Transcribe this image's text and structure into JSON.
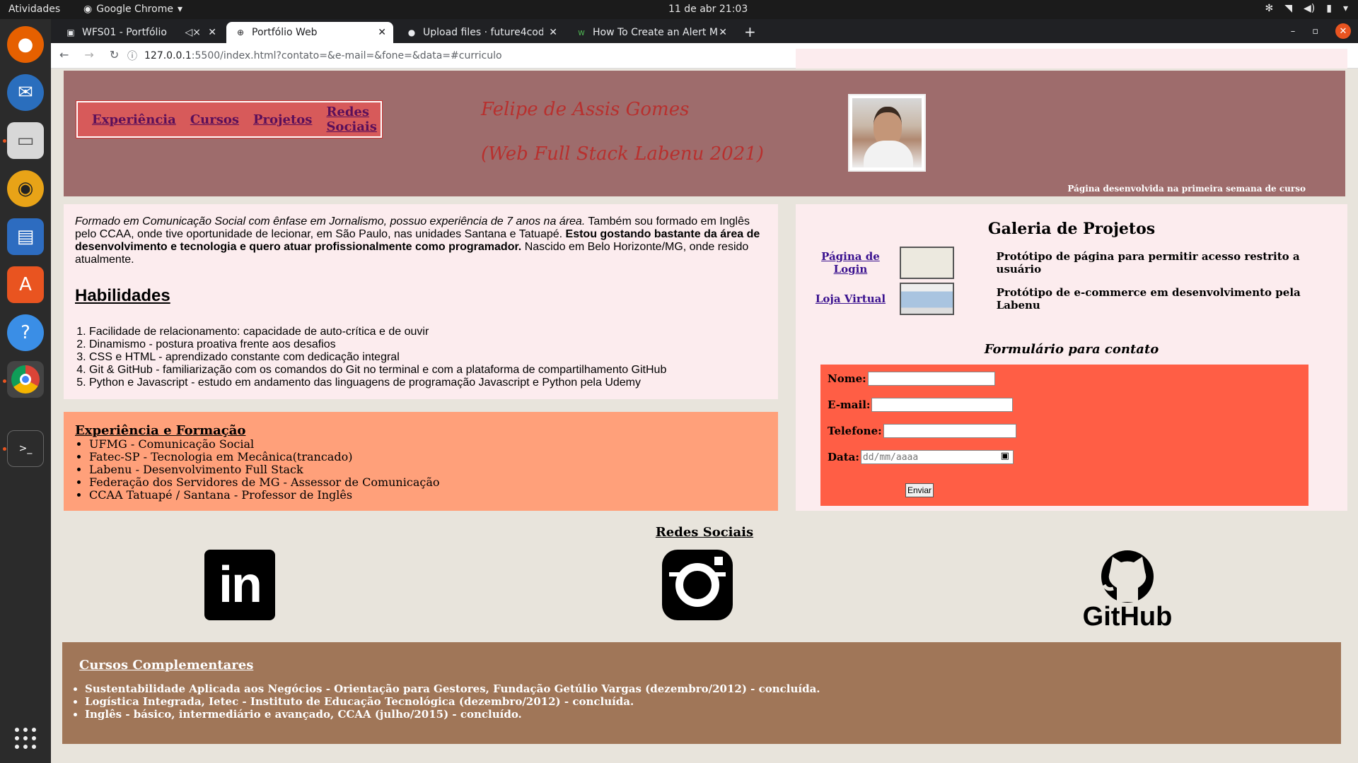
{
  "os": {
    "activities": "Atividades",
    "app_name": "Google Chrome",
    "clock": "11 de abr  21:03"
  },
  "browser": {
    "tabs": [
      {
        "title": "WFS01 - Portfólio"
      },
      {
        "title": "Portfólio Web"
      },
      {
        "title": "Upload files · future4code"
      },
      {
        "title": "How To Create an Alert M"
      }
    ],
    "url_host": "127.0.0.1",
    "url_rest": ":5500/index.html?contato=&e-mail=&fone=&data=#curriculo"
  },
  "header": {
    "nav": [
      "Experiência",
      "Cursos",
      "Projetos",
      "Redes Sociais"
    ],
    "name": "Felipe de Assis Gomes",
    "subtitle": "(Web Full Stack Labenu 2021)",
    "note": "Página desenvolvida na primeira semana de curso"
  },
  "bio": {
    "text_italic": "Formado em Comunicação Social com ênfase em Jornalismo, possuo experiência de 7 anos na área.",
    "text_1": " Também sou formado em Inglês pelo CCAA, onde tive oportunidade de lecionar, em São Paulo, nas unidades Santana e Tatuapé. ",
    "text_bold": "Estou gostando bastante da área de desenvolvimento e tecnologia e quero atuar profissionalmente como programador.",
    "text_2": " Nascido em Belo Horizonte/MG, onde resido atualmente.",
    "skills_title": "Habilidades",
    "skills": [
      "Facilidade de relacionamento: capacidade de auto-crítica e de ouvir",
      "Dinamismo - postura proativa frente aos desafios",
      "CSS e HTML - aprendizado constante com dedicação integral",
      "Git & GitHub - familiarização com os comandos do Git no terminal e com a plataforma de compartilhamento GitHub",
      "Python e Javascript - estudo em andamento das linguagens de programação Javascript e Python pela Udemy"
    ]
  },
  "experience": {
    "title": "Experiência e Formação",
    "items": [
      "UFMG - Comunicação Social",
      "Fatec-SP - Tecnologia em Mecânica(trancado)",
      "Labenu - Desenvolvimento Full Stack",
      "Federação dos Servidores de MG - Assessor de Comunicação",
      "CCAA Tatuapé / Santana - Professor de Inglês"
    ]
  },
  "gallery": {
    "title": "Galeria de Projetos",
    "projects": [
      {
        "link": "Página de Login",
        "desc": "Protótipo de página para permitir acesso restrito a usuário"
      },
      {
        "link": "Loja Virtual",
        "desc": "Protótipo de e-commerce em desenvolvimento pela Labenu"
      }
    ]
  },
  "form": {
    "title": "Formulário para contato",
    "name_label": "Nome:",
    "email_label": "E-mail:",
    "phone_label": "Telefone:",
    "date_label": "Data:",
    "date_placeholder": "dd/mm/aaaa",
    "submit": "Enviar"
  },
  "social": {
    "title": "Redes Sociais",
    "linkedin_text": "in",
    "github_text": "GitHub"
  },
  "courses": {
    "title": "Cursos Complementares",
    "items": [
      "Sustentabilidade Aplicada aos Negócios - Orientação para Gestores, Fundação Getúlio Vargas (dezembro/2012) - concluída.",
      "Logística Integrada, Ietec - Instituto de Educação Tecnológica (dezembro/2012) - concluída.",
      "Inglês - básico, intermediário e avançado, CCAA (julho/2015) - concluído."
    ]
  }
}
